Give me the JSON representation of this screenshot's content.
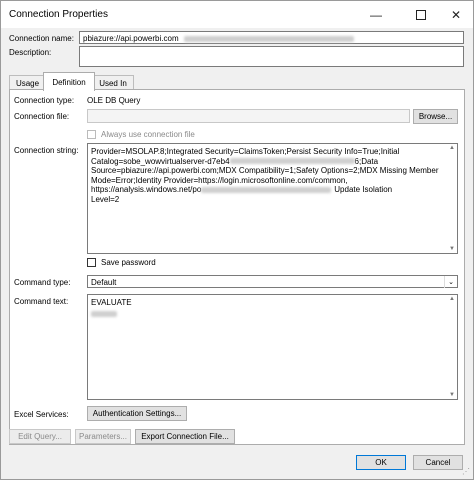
{
  "window": {
    "title": "Connection Properties"
  },
  "connection_name": {
    "label": "Connection name:",
    "value": "pbiazure://api.powerbi.com"
  },
  "description": {
    "label": "Description:",
    "value": ""
  },
  "tabs": [
    {
      "label": "Usage"
    },
    {
      "label": "Definition"
    },
    {
      "label": "Used In"
    }
  ],
  "definition": {
    "connection_type_label": "Connection type:",
    "connection_type_value": "OLE DB Query",
    "connection_file_label": "Connection file:",
    "connection_file_value": "",
    "browse_label": "Browse...",
    "always_use_label": "Always use connection file",
    "connection_string_label": "Connection string:",
    "connection_string_line1": "Provider=MSOLAP.8;Integrated Security=ClaimsToken;Persist Security Info=True;Initial",
    "connection_string_line2a": "Catalog=sobe_wowvirtualserver-d7eb4",
    "connection_string_line2b": "6;Data",
    "connection_string_line3": "Source=pbiazure://api.powerbi.com;MDX Compatibility=1;Safety Options=2;MDX Missing Member",
    "connection_string_line4": "Mode=Error;Identity Provider=https://login.microsoftonline.com/common,",
    "connection_string_line5a": "https://analysis.windows.net/po",
    "connection_string_line5b": "Update Isolation",
    "connection_string_line6": "Level=2",
    "save_password_label": "Save password",
    "command_type_label": "Command type:",
    "command_type_value": "Default",
    "command_text_label": "Command text:",
    "command_text_value": "EVALUATE",
    "excel_services_label": "Excel Services:",
    "auth_settings_label": "Authentication Settings..."
  },
  "bottom_buttons": {
    "edit_query": "Edit Query...",
    "parameters": "Parameters...",
    "export": "Export Connection File..."
  },
  "footer": {
    "ok": "OK",
    "cancel": "Cancel"
  }
}
